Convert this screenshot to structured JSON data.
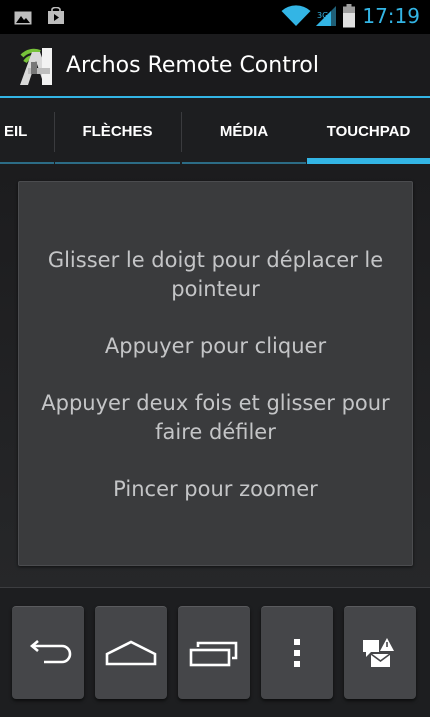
{
  "status_bar": {
    "time": "17:19",
    "left_icons": [
      "image-icon",
      "shopping-bag-icon"
    ],
    "right_icons": [
      "wifi-icon",
      "cell-signal-icon",
      "battery-icon"
    ],
    "accent_color": "#33b5e5"
  },
  "action_bar": {
    "title": "Archos Remote Control",
    "app_icon": "archos-remote-app-icon"
  },
  "tabs": [
    {
      "label": "EIL",
      "selected": false
    },
    {
      "label": "FLÈCHES",
      "selected": false
    },
    {
      "label": "MÉDIA",
      "selected": false
    },
    {
      "label": "TOUCHPAD",
      "selected": true
    }
  ],
  "touchpad": {
    "instructions": [
      "Glisser le doigt pour déplacer le pointeur",
      "Appuyer pour cliquer",
      "Appuyer deux fois et glisser pour faire défiler",
      "Pincer pour zoomer"
    ]
  },
  "bottom_keys": [
    {
      "name": "back-key",
      "icon": "back-arrow-icon"
    },
    {
      "name": "home-key",
      "icon": "home-icon"
    },
    {
      "name": "recent-apps-key",
      "icon": "recent-apps-icon"
    },
    {
      "name": "menu-key",
      "icon": "overflow-menu-icon"
    },
    {
      "name": "notifications-key",
      "icon": "notifications-icon"
    }
  ]
}
